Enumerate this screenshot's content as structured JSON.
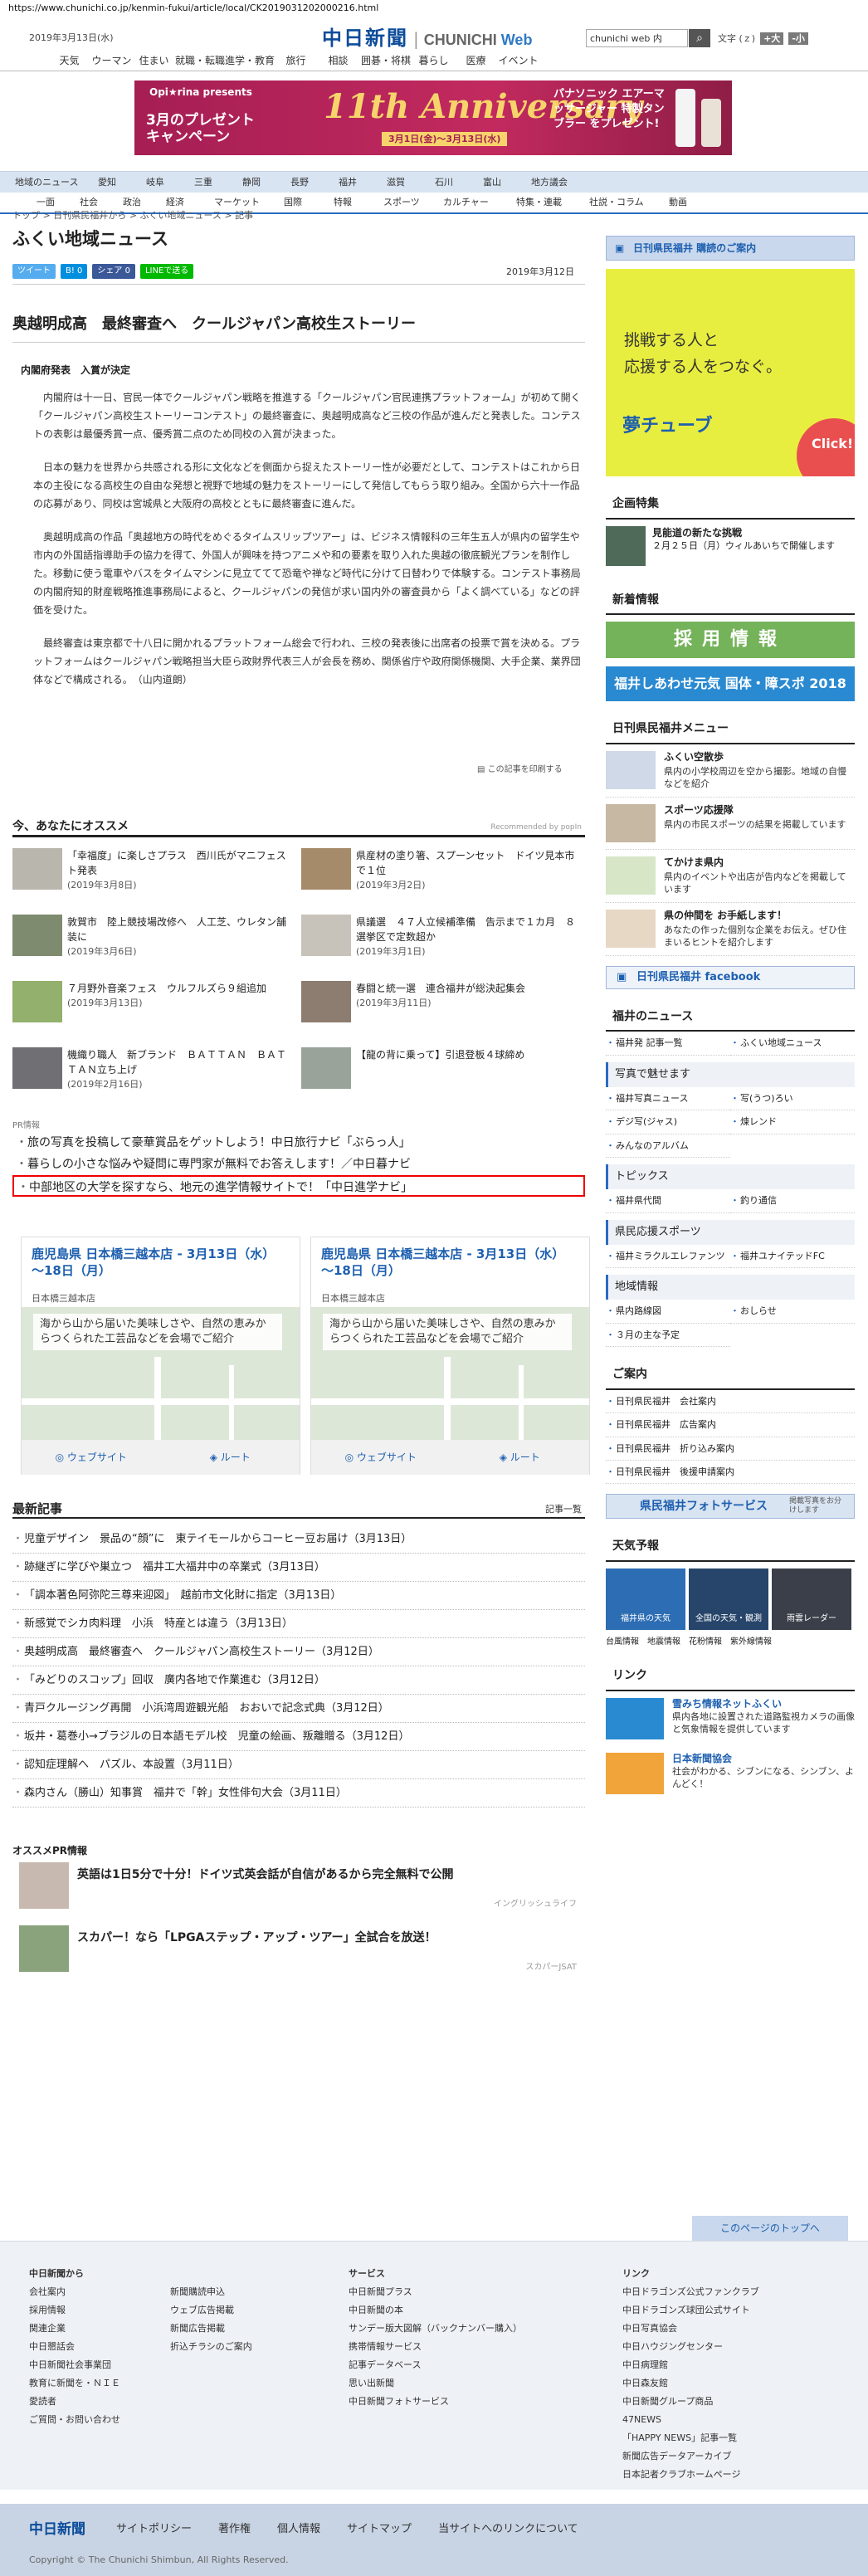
{
  "url": "https://www.chunichi.co.jp/kenmin-fukui/article/local/CK2019031202000216.html",
  "header": {
    "date": "2019年3月13日(水)",
    "logo_jp": "中日新聞",
    "logo_en_prefix": "CHUNICHI",
    "logo_en_suffix": "Web",
    "search_value": "chunichi web 内",
    "tools": [
      "文字 (ｚ)",
      "+大",
      "-小"
    ]
  },
  "global_nav": [
    "天気",
    "ウーマン",
    "住まい",
    "就職・転職",
    "進学・教育",
    "旅行",
    "相談",
    "囲碁・将棋",
    "暮らし",
    "医療",
    "イベント"
  ],
  "banner": {
    "brand": "Opi★rina presents",
    "present": "3月のプレゼント\nキャンペーン",
    "anniversary": "11th Anniversary",
    "dates": "3月1日(金)～3月13日(水)",
    "right": "パナソニック エアーマッサージャー 特製タンブラー をプレゼント!"
  },
  "region_nav": [
    "地域のニュース",
    "愛知",
    "岐阜",
    "三重",
    "静岡",
    "長野",
    "福井",
    "滋賀",
    "石川",
    "富山",
    "地方議会"
  ],
  "section_nav": [
    "一面",
    "社会",
    "政治",
    "経済",
    "マーケット",
    "国際",
    "特報",
    "スポーツ",
    "カルチャー",
    "特集・連載",
    "社説・コラム",
    "動画"
  ],
  "breadcrumb": "トップ > 日刊県民福井から > ふくい地域ニュース > 記事",
  "page_title": "ふくい地域ニュース",
  "share": {
    "tweet": "ツイート",
    "b": "B! 0",
    "fb": "シェア 0",
    "line": "LINEで送る",
    "date": "2019年3月12日"
  },
  "article": {
    "title": "奥越明成高　最終審査へ　クールジャパン高校生ストーリー",
    "subtitle": "内閣府発表　入賞が決定",
    "paragraphs": [
      "内閣府は十一日、官民一体でクールジャパン戦略を推進する「クールジャパン官民連携プラットフォーム」が初めて開く「クールジャパン高校生ストーリーコンテスト」の最終審査に、奥越明成高など三校の作品が進んだと発表した。コンテストの表彰は最優秀賞一点、優秀賞二点のため同校の入賞が決まった。",
      "日本の魅力を世界から共感される形に文化などを側面から捉えたストーリー性が必要だとして、コンテストはこれから日本の主役になる高校生の自由な発想と視野で地域の魅力をストーリーにして発信してもらう取り組み。全国から六十一作品の応募があり、同校は宮城県と大阪府の高校とともに最終審査に進んだ。",
      "奥越明成高の作品「奥越地方の時代をめぐるタイムスリップツアー」は、ビジネス情報科の三年生五人が県内の留学生や市内の外国語指導助手の協力を得て、外国人が興味を持つアニメや和の要素を取り入れた奥越の徹底観光プランを制作した。移動に使う電車やバスをタイムマシンに見立ててて恐竜や禅など時代に分けて日替わりで体験する。コンテスト事務局の内閣府知的財産戦略推進事務局によると、クールジャパンの発信が求い国内外の審査員から「よく調べている」などの評価を受けた。",
      "最終審査は東京都で十八日に開かれるプラットフォーム総会で行われ、三校の発表後に出席者の投票で賞を決める。プラットフォームはクールジャパン戦略担当大臣ら政財界代表三人が会長を務め、関係省庁や政府関係機関、大手企業、業界団体などで構成される。　（山内道朗）"
    ],
    "print_link": "この記事を印刷する"
  },
  "recommend": {
    "title": "今、あなたにオススメ",
    "by": "Recommended by popIn",
    "items": [
      {
        "title": "「幸福度」に楽しさプラス　西川氏がマニフェスト発表",
        "date": "(2019年3月8日)"
      },
      {
        "title": "県産材の塗り箸、スプーンセット　ドイツ見本市で１位",
        "date": "(2019年3月2日)"
      },
      {
        "title": "敦賀市　陸上競技場改修へ　人工芝、ウレタン舗装に",
        "date": "(2019年3月6日)"
      },
      {
        "title": "県議選　４７人立候補準備　告示まで１カ月　８選挙区で定数超か",
        "date": "(2019年3月1日)"
      },
      {
        "title": "７月野外音楽フェス　ウルフルズら９組追加",
        "date": "(2019年3月13日)"
      },
      {
        "title": "春闘と統一選　連合福井が総決起集会",
        "date": "(2019年3月11日)"
      },
      {
        "title": "機織り職人　新ブランド　ＢＡＴＴＡＮ　ＢＡＴＴＡＮ立ち上げ",
        "date": "(2019年2月16日)"
      },
      {
        "title": "【龍の背に乗って】引退登板４球締め",
        "date": ""
      }
    ]
  },
  "pr": {
    "label": "PR情報",
    "links": [
      "旅の写真を投稿して豪華賞品をゲットしよう！中日旅行ナビ「ぶらっ人」",
      "暮らしの小さな悩みや疑問に専門家が無料でお答えします！／中日暮ナビ",
      "中部地区の大学を探すなら、地元の進学情報サイトで！「中日進学ナビ」"
    ]
  },
  "map_ads": [
    {
      "name": "鹿児島県 日本橋三越本店 - 3月13日（水）～18日（月）",
      "sub": "日本橋三越本店",
      "text": "海から山から届いた美味しさや、自然の恵みからつくられた工芸品などを会場でご紹介",
      "website": "ウェブサイト",
      "route": "ルート"
    },
    {
      "name": "鹿児島県 日本橋三越本店 - 3月13日（水）～18日（月）",
      "sub": "日本橋三越本店",
      "text": "海から山から届いた美味しさや、自然の恵みからつくられた工芸品などを会場でご紹介",
      "website": "ウェブサイト",
      "route": "ルート"
    }
  ],
  "latest": {
    "title": "最新記事",
    "more": "記事一覧",
    "items": [
      "児童デザイン　景品の“顔”に　東テイモールからコーヒー豆お届け（3月13日）",
      "跡継ぎに学びや巣立つ　福井工大福井中の卒業式（3月13日）",
      "「調本著色阿弥陀三尊来迎図」　越前市文化財に指定（3月13日）",
      "新感覚でシカ肉料理　小浜　特産とは違う（3月13日）",
      "奥越明成高　最終審査へ　クールジャパン高校生ストーリー（3月12日）",
      "「みどりのスコップ」回収　廣内各地で作業進む（3月12日）",
      "青戸クルージング再開　小浜湾周遊観光船　おおいで記念式典（3月12日）",
      "坂井・葛巻小→ブラジルの日本語モデル校　児童の絵画、叛離贈る（3月12日）",
      "認知症理解へ　パズル、本設置（3月11日）",
      "森内さん（勝山）知事賞　福井で「幹」女性俳句大会（3月11日）"
    ]
  },
  "osusume_pr": {
    "label": "オススメPR情報",
    "items": [
      {
        "text": "英語は1日5分で十分！ドイツ式英会話が自信があるから完全無料で公開",
        "sponsor": "イングリッシュライフ"
      },
      {
        "text": "スカパー！なら「LPGAステップ・アップ・ツアー」全試合を放送！",
        "sponsor": "スカパーJSAT"
      }
    ]
  },
  "sidebar": {
    "subscribe": "日刊県民福井 購読のご案内",
    "ad_text": "挑戦する人と\n応援する人をつなぐ。",
    "ad_logo": "夢チューブ",
    "ad_click": "Click!",
    "feature_title": "企画特集",
    "feature_item_title": "見能道の新たな挑戦",
    "feature_item_text": "２月２５日（月）ウィルあいちで開催します",
    "newbook_title": "新着情報",
    "recruit": "採用情報",
    "recruit2": "福井しあわせ元気 国体・障スポ 2018",
    "menu_title": "日刊県民福井メニュー",
    "menu_items": [
      {
        "title": "ふくい空散歩",
        "text": "県内の小学校周辺を空から撮影。地域の自慢などを紹介"
      },
      {
        "title": "スポーツ応援隊",
        "text": "県内の市民スポーツの結果を掲載しています"
      },
      {
        "title": "てかけま県内",
        "text": "県内のイベントや出店が告内などを掲載しています"
      },
      {
        "title": "県の仲間を お手紙します！",
        "text": "あなたの作った個別な企業をお伝え。ぜひ住まいるヒントを紹介します"
      }
    ],
    "fb": "日刊県民福井 facebook",
    "news_title": "福井のニュース",
    "news_links": [
      "福井発 記事一覧",
      "ふくい地域ニュース"
    ],
    "cat_photo": "写真で魅せます",
    "photo_links": [
      "福井写真ニュース",
      "写(うつ)ろい",
      "デジ写(ジャス)",
      "煉レンド",
      "みんなのアルバム"
    ],
    "cat_topics": "トピックス",
    "topic_links": [
      "福井県代間",
      "釣り通信"
    ],
    "cat_sports": "県民応援スポーツ",
    "sports_links": [
      "福井ミラクルエレファンツ",
      "福井ユナイテッドFC"
    ],
    "cat_info": "地域情報",
    "info_links": [
      "県内路線図",
      "おしらせ",
      "３月の主な予定"
    ],
    "guide_title": "ご案内",
    "guide_links": [
      "日刊県民福井　会社案内",
      "日刊県民福井　広告案内",
      "日刊県民福井　折り込み案内",
      "日刊県民福井　後援申請案内"
    ],
    "photo_service": "県民福井フォトサービス",
    "photo_service_note": "掲載写真をお分けします",
    "weather_title": "天気予報",
    "weather_boxes": [
      "福井県の天気",
      "全国の天気・観測",
      "雨雲レーダー"
    ],
    "weather_links": [
      "台風情報",
      "地震情報",
      "花粉情報",
      "紫外線情報"
    ],
    "link_title": "リンク",
    "link_items": [
      {
        "title": "雪みち情報ネットふくい",
        "text": "県内各地に設置された道路監視カメラの画像と気象情報を提供しています"
      },
      {
        "title": "日本新聞協会",
        "text": "社会がわかる、シブンになる、シンブン、よんどく！"
      }
    ]
  },
  "pagetop": "このページのトップへ",
  "footer": {
    "col1_title": "中日新聞から",
    "col1": [
      "会社案内",
      "採用情報",
      "関連企業",
      "中日新聞社会事業団",
      "お問い合わせ",
      "ご質問・お問い合わせ"
    ],
    "col1b": [
      "新聞購読申込",
      "ウェブ広告掲載",
      "新聞広告掲載",
      "折込チラシのご案内"
    ],
    "col1c": [
      "中日懇話会",
      "中日新聞社会事業団",
      "教育に新聞を・ＮＩＥ",
      "愛読者"
    ],
    "col2_title": "サービス",
    "col2": [
      "中日新聞プラス",
      "中日新聞の本",
      "サンデー版大図解（バックナンバー購入）",
      "携帯情報サービス",
      "記事データベース",
      "思い出新聞",
      "中日新聞フォトサービス"
    ],
    "col3_title": "リンク",
    "col3": [
      "中日ドラゴンズ公式ファンクラブ",
      "中日ドラゴンズ球団公式サイト",
      "中日写真協会",
      "中日ハウジングセンター",
      "中日病理館",
      "中日森友館",
      "中日新聞グループ商品",
      "47NEWS",
      "「HAPPY NEWS」記事一覧",
      "新聞広告データアーカイブ",
      "日本記者クラブホームページ"
    ],
    "logo": "中日新聞",
    "links": [
      "サイトポリシー",
      "著作権",
      "個人情報",
      "サイトマップ",
      "当サイトへのリンクについて"
    ],
    "copyright": "Copyright © The Chunichi Shimbun, All Rights Reserved."
  }
}
